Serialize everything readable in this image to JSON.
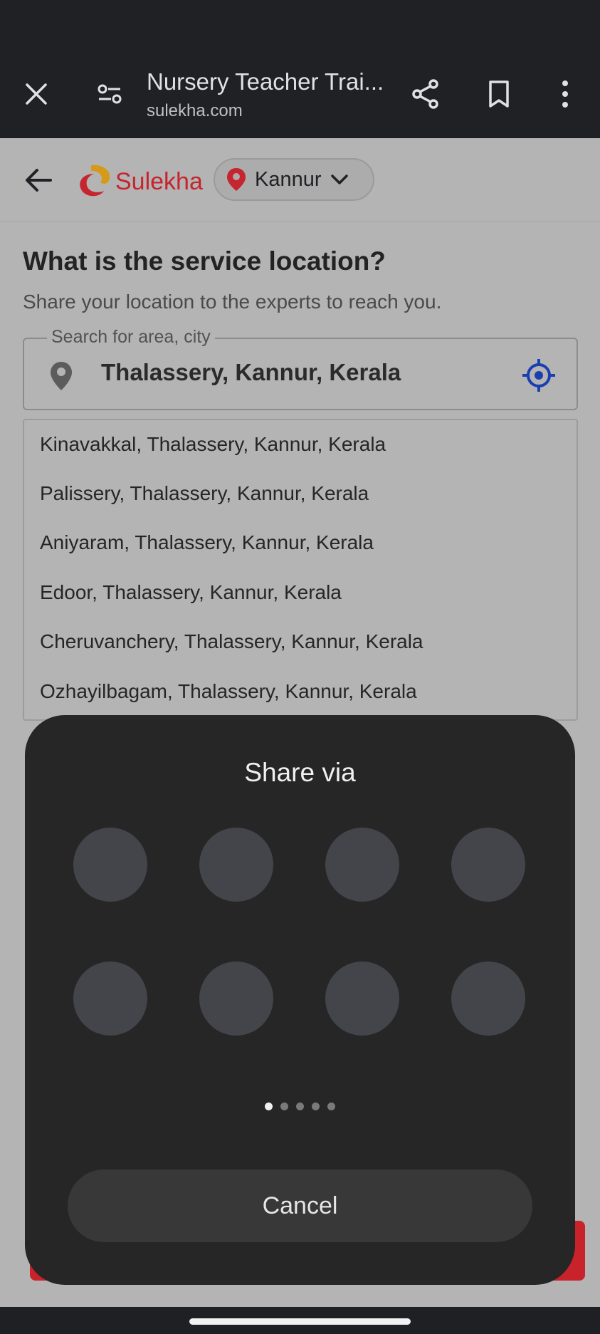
{
  "browser": {
    "title": "Nursery Teacher Trai...",
    "domain": "sulekha.com",
    "icons": [
      "close-icon",
      "site-settings-icon",
      "share-icon",
      "bookmark-icon",
      "more-vert-icon"
    ]
  },
  "site": {
    "logo_text": "Sulekha",
    "city": "Kannur",
    "brand_color": "#c6242e"
  },
  "form": {
    "heading": "What is the service location?",
    "subheading": "Share your location to the experts to reach you.",
    "search_label": "Search for area, city",
    "search_value": "Thalassery, Kannur, Kerala",
    "suggestions": [
      "Kinavakkal, Thalassery, Kannur, Kerala",
      "Palissery, Thalassery, Kannur, Kerala",
      "Aniyaram, Thalassery, Kannur, Kerala",
      "Edoor, Thalassery, Kannur, Kerala",
      "Cheruvanchery, Thalassery, Kannur, Kerala",
      "Ozhayilbagam, Thalassery, Kannur, Kerala"
    ]
  },
  "share_sheet": {
    "title": "Share via",
    "app_count": 8,
    "page_count": 5,
    "active_page": 1,
    "cancel_label": "Cancel"
  }
}
